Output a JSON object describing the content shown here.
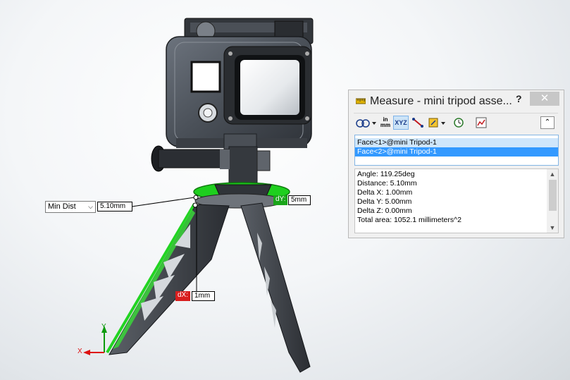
{
  "callouts": {
    "min_dist_dropdown": "Min Dist",
    "min_dist_value": "5.10mm",
    "dy_label": "dY:",
    "dy_value": "5mm",
    "dx_label": "dX:",
    "dx_value": "1mm"
  },
  "triad": {
    "x_label": "X",
    "y_label": "Y"
  },
  "measure_panel": {
    "title": "Measure - mini tripod asse...",
    "help_label": "?",
    "close_label": "✕",
    "toolbar": {
      "arc_circle_icon": "arc-circle-options-icon",
      "units_label_top": "in",
      "units_label_bottom": "mm",
      "xyz_label": "XYZ",
      "point_to_point_icon": "point-to-point-icon",
      "projection_icon": "projection-icon",
      "history_icon": "history-icon",
      "sensor_icon": "sensor-icon",
      "collapse_label": "⌃"
    },
    "selections": [
      "Face<1>@mini Tripod-1",
      "Face<2>@mini Tripod-1"
    ],
    "results": [
      "Angle: 119.25deg",
      "Distance: 5.10mm",
      "Delta X: 1.00mm",
      "Delta Y: 5.00mm",
      "Delta Z: 0.00mm",
      "Total area: 1052.1 millimeters^2"
    ]
  },
  "colors": {
    "highlight_green": "#22cc22",
    "tag_green": "#1aa51a",
    "tag_red": "#d81e1e",
    "selection_blue": "#3399ff",
    "close_button": "#c7c7c7"
  }
}
